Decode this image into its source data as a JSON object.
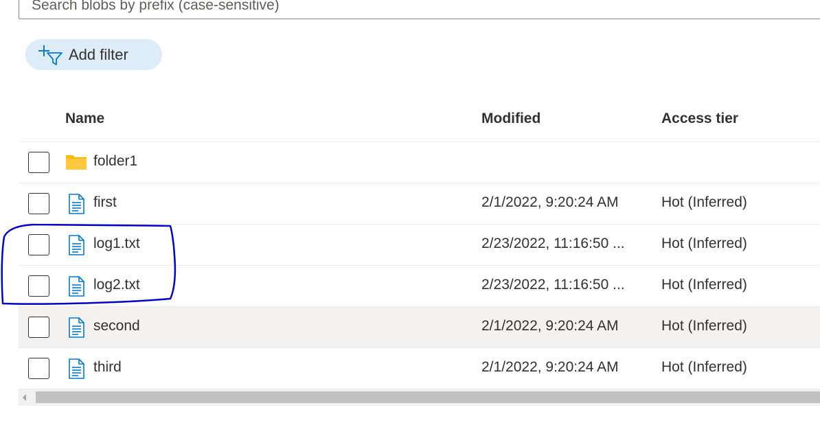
{
  "search": {
    "placeholder": "Search blobs by prefix (case-sensitive)",
    "value": ""
  },
  "filter": {
    "add_label": "Add filter",
    "icon": "add-filter-icon"
  },
  "table": {
    "columns": [
      "Name",
      "Modified",
      "Access tier"
    ],
    "rows": [
      {
        "icon": "folder-icon",
        "name": "folder1",
        "modified": "",
        "tier": ""
      },
      {
        "icon": "file-icon",
        "name": "first",
        "modified": "2/1/2022, 9:20:24 AM",
        "tier": "Hot (Inferred)"
      },
      {
        "icon": "file-icon",
        "name": "log1.txt",
        "modified": "2/23/2022, 11:16:50 ...",
        "tier": "Hot (Inferred)"
      },
      {
        "icon": "file-icon",
        "name": "log2.txt",
        "modified": "2/23/2022, 11:16:50 ...",
        "tier": "Hot (Inferred)"
      },
      {
        "icon": "file-icon",
        "name": "second",
        "modified": "2/1/2022, 9:20:24 AM",
        "tier": "Hot (Inferred)"
      },
      {
        "icon": "file-icon",
        "name": "third",
        "modified": "2/1/2022, 9:20:24 AM",
        "tier": "Hot (Inferred)"
      }
    ]
  },
  "colors": {
    "accent": "#0078d4",
    "folder": "#ffb900",
    "filter_pill": "#deecf9",
    "hover_row": "#f3f2f1",
    "annotation": "#0000cc"
  }
}
